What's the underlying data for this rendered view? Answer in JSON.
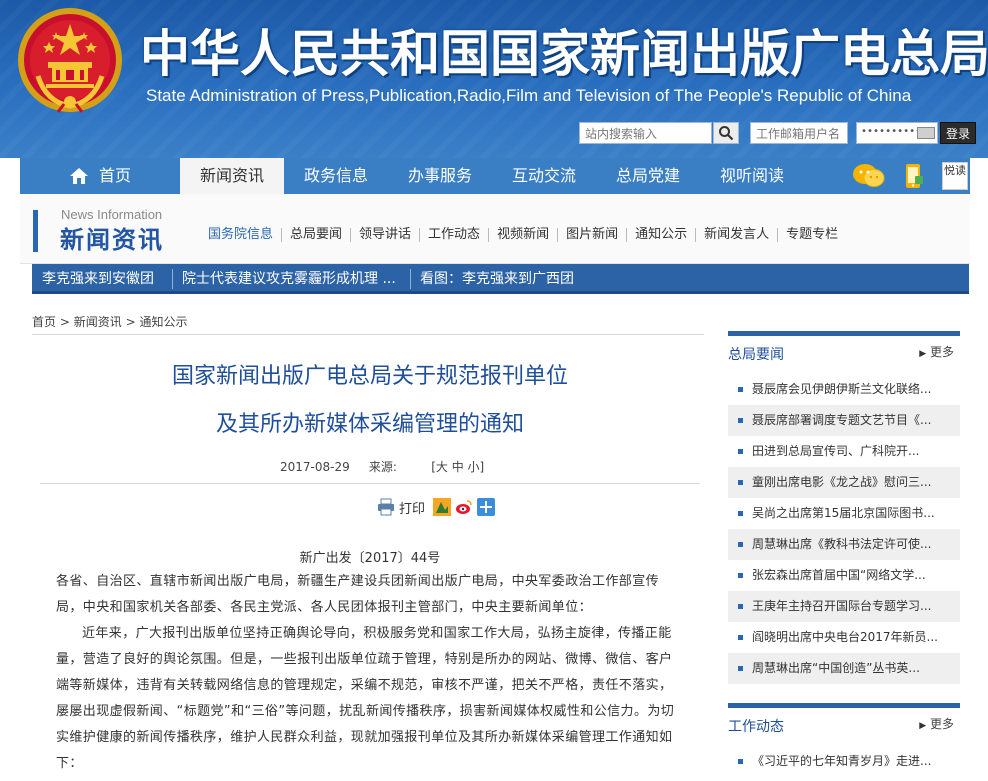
{
  "header": {
    "title_cn": "中华人民共和国国家新闻出版广电总局",
    "title_en": "State Administration of Press,Publication,Radio,Film and Television of The People's Republic of China",
    "search_placeholder": "站内搜索输入",
    "mail_placeholder": "工作邮箱用户名",
    "password_mask": "••••••••••",
    "login_label": "登录"
  },
  "nav": {
    "items": [
      {
        "label": "首页"
      },
      {
        "label": "新闻资讯"
      },
      {
        "label": "政务信息"
      },
      {
        "label": "办事服务"
      },
      {
        "label": "互动交流"
      },
      {
        "label": "总局党建"
      },
      {
        "label": "视听阅读"
      }
    ],
    "icons": [
      "wechat-icon",
      "mobile-icon",
      "reading-icon"
    ],
    "reading_icon_text": "悦读"
  },
  "subnav": {
    "section_en": "News Information",
    "section_cn": "新闻资讯",
    "links": [
      "国务院信息",
      "总局要闻",
      "领导讲话",
      "工作动态",
      "视频新闻",
      "图片新闻",
      "通知公示",
      "新闻发言人",
      "专题专栏"
    ]
  },
  "ticker": {
    "items": [
      "李克强来到安徽团",
      "院士代表建议攻克雾霾形成机理 ...",
      "看图：李克强来到广西团"
    ]
  },
  "breadcrumb": {
    "items": [
      "首页",
      "新闻资讯",
      "通知公示"
    ],
    "separator": ">"
  },
  "article": {
    "title_line1": "国家新闻出版广电总局关于规范报刊单位",
    "title_line2": "及其所办新媒体采编管理的通知",
    "date": "2017-08-29",
    "source_label": "来源:",
    "font_size_label": "[大 中 小]",
    "print_label": "打印",
    "doc_number": "新广出发〔2017〕44号",
    "paragraphs": [
      "各省、自治区、直辖市新闻出版广电局，新疆生产建设兵团新闻出版广电局，中央军委政治工作部宣传局，中央和国家机关各部委、各民主党派、各人民团体报刊主管部门，中央主要新闻单位：",
      "近年来，广大报刊出版单位坚持正确舆论导向，积极服务党和国家工作大局，弘扬主旋律，传播正能量，营造了良好的舆论氛围。但是，一些报刊出版单位疏于管理，特别是所办的网站、微博、微信、客户端等新媒体，违背有关转载网络信息的管理规定，采编不规范，审核不严谨，把关不严格，责任不落实，屡屡出现虚假新闻、“标题党”和“三俗”等问题，扰乱新闻传播秩序，损害新闻媒体权威性和公信力。为切实维护健康的新闻传播秩序，维护人民群众利益，现就加强报刊单位及其所办新媒体采编管理工作通知如下："
    ]
  },
  "sidebar": {
    "more_label": "更多",
    "section1_title": "总局要闻",
    "section1_items": [
      "聂辰席会见伊朗伊斯兰文化联络...",
      "聂辰席部署调度专题文艺节目《...",
      "田进到总局宣传司、广科院开...",
      "童刚出席电影《龙之战》慰问三...",
      "吴尚之出席第15届北京国际图书...",
      "周慧琳出席《教科书法定许可使...",
      "张宏森出席首届中国“网络文学...",
      "王庚年主持召开国际台专题学习...",
      "阎晓明出席中央电台2017年新员...",
      "周慧琳出席“中国创造”丛书英..."
    ],
    "section2_title": "工作动态",
    "section2_items": [
      "《习近平的七年知青岁月》走进..."
    ]
  },
  "colors": {
    "header_blue": "#2a6fbf",
    "nav_blue": "#3a7fc4",
    "title_blue": "#1f4f9a",
    "ticker_blue": "#2c62a6"
  }
}
